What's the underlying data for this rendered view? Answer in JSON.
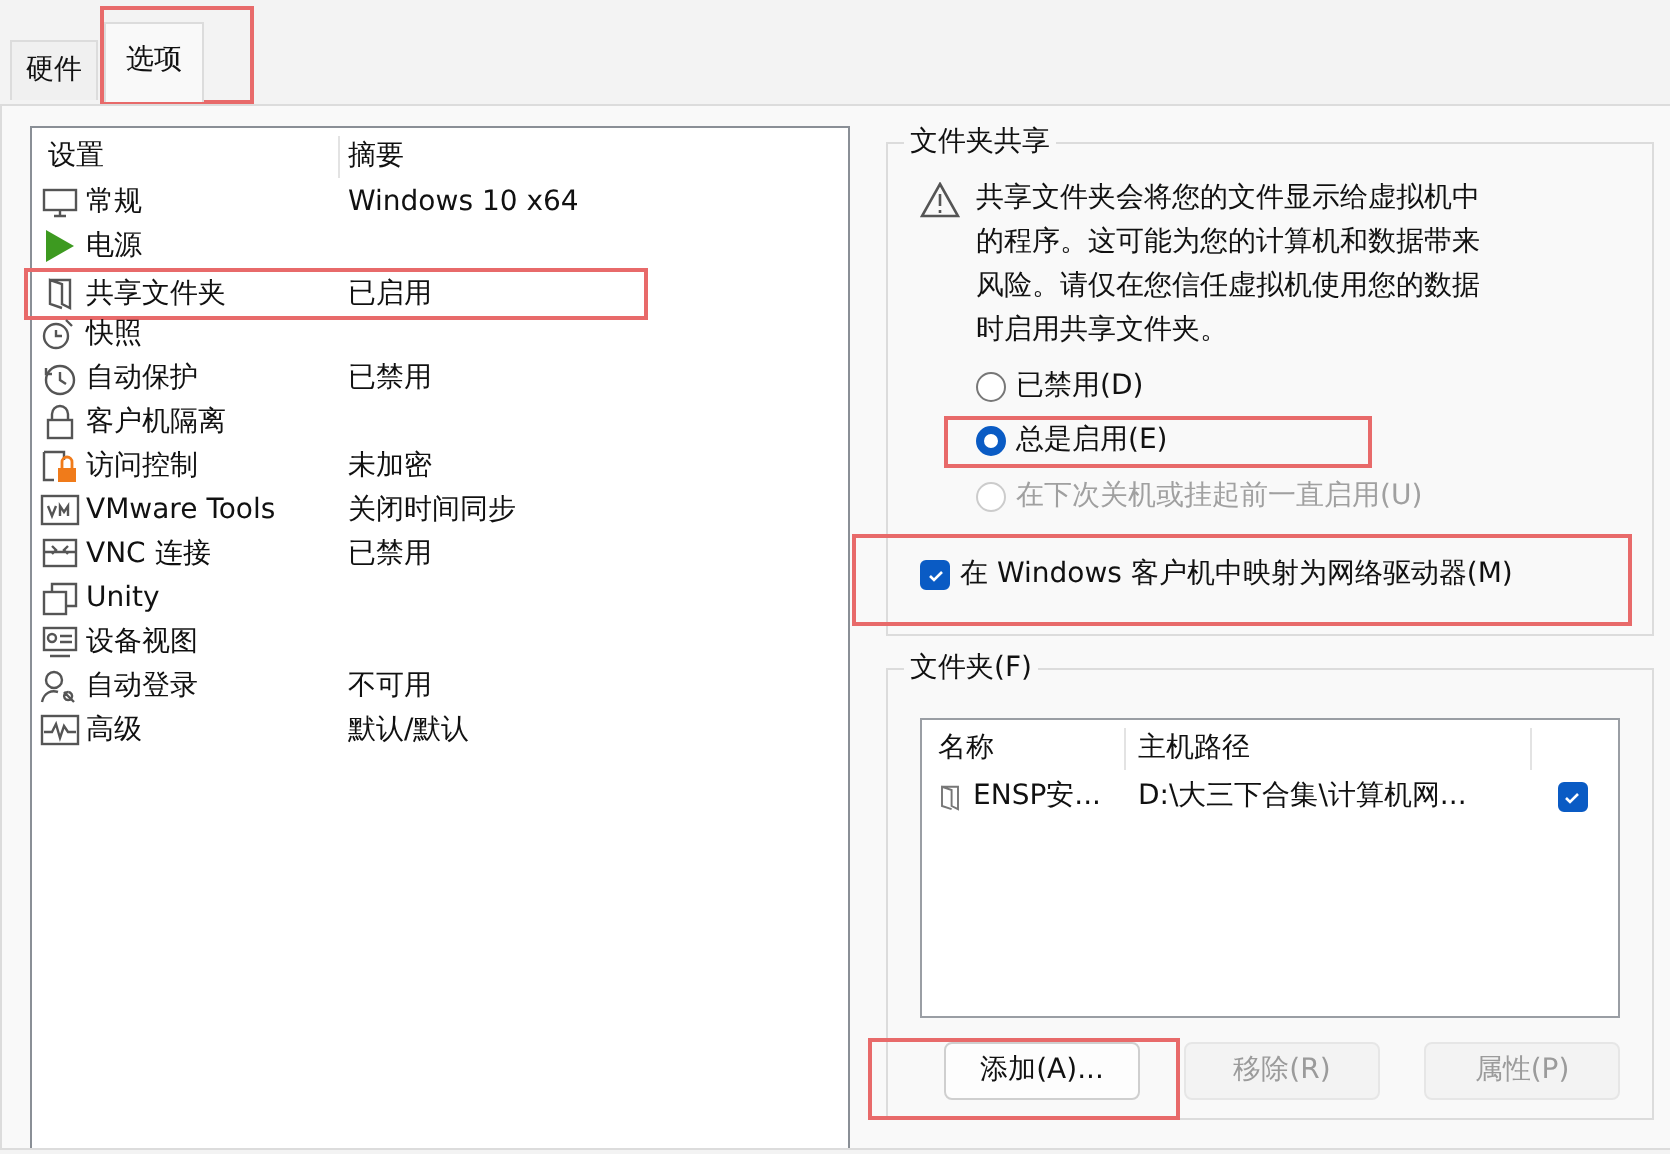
{
  "tabs": [
    {
      "label": "硬件",
      "selected": false,
      "highlighted": false
    },
    {
      "label": "选项",
      "selected": true,
      "highlighted": true
    }
  ],
  "settings": {
    "columns": [
      "设置",
      "摘要"
    ],
    "items": [
      {
        "name": "常规",
        "summary": "Windows 10 x64",
        "highlighted": false
      },
      {
        "name": "电源",
        "highlighted": false
      },
      {
        "name": "共享文件夹",
        "summary": "已启用",
        "highlighted": true
      },
      {
        "name": "快照",
        "highlighted": false
      },
      {
        "name": "自动保护",
        "summary": "已禁用",
        "highlighted": false
      },
      {
        "name": "客户机隔离",
        "highlighted": false
      },
      {
        "name": "访问控制",
        "summary": "未加密",
        "highlighted": false
      },
      {
        "name": "VMware Tools",
        "summary": "关闭时间同步",
        "highlighted": false
      },
      {
        "name": "VNC 连接",
        "summary": "已禁用",
        "highlighted": false
      },
      {
        "name": "Unity",
        "highlighted": false
      },
      {
        "name": "设备视图",
        "highlighted": false
      },
      {
        "name": "自动登录",
        "summary": "不可用",
        "highlighted": false
      },
      {
        "name": "高级",
        "summary": "默认/默认",
        "highlighted": false
      }
    ]
  },
  "folder_sharing": {
    "title": "文件夹共享",
    "warning": "共享文件夹会将您的文件显示给虚拟机中的程序。这可能为您的计算机和数据带来风险。请仅在您信任虚拟机使用您的数据时启用共享文件夹。",
    "options": [
      {
        "label": "已禁用(D)",
        "selected": false,
        "disabled": false,
        "highlighted": false
      },
      {
        "label": "总是启用(E)",
        "selected": true,
        "disabled": false,
        "highlighted": true
      },
      {
        "label": "在下次关机或挂起前一直启用(U)",
        "selected": false,
        "disabled": true,
        "highlighted": false
      }
    ],
    "map_drive": {
      "label": "在 Windows 客户机中映射为网络驱动器(M)",
      "checked": true,
      "highlighted": true
    }
  },
  "folders": {
    "title": "文件夹(F)",
    "columns": [
      "名称",
      "主机路径"
    ],
    "rows": [
      {
        "name": "ENSP安...",
        "path": "D:\\大三下合集\\计算机网...",
        "enabled": true
      }
    ],
    "buttons": [
      {
        "label": "添加(A)...",
        "disabled": false,
        "highlighted": true
      },
      {
        "label": "移除(R)",
        "disabled": true,
        "highlighted": false
      },
      {
        "label": "属性(P)",
        "disabled": true,
        "highlighted": false
      }
    ]
  }
}
